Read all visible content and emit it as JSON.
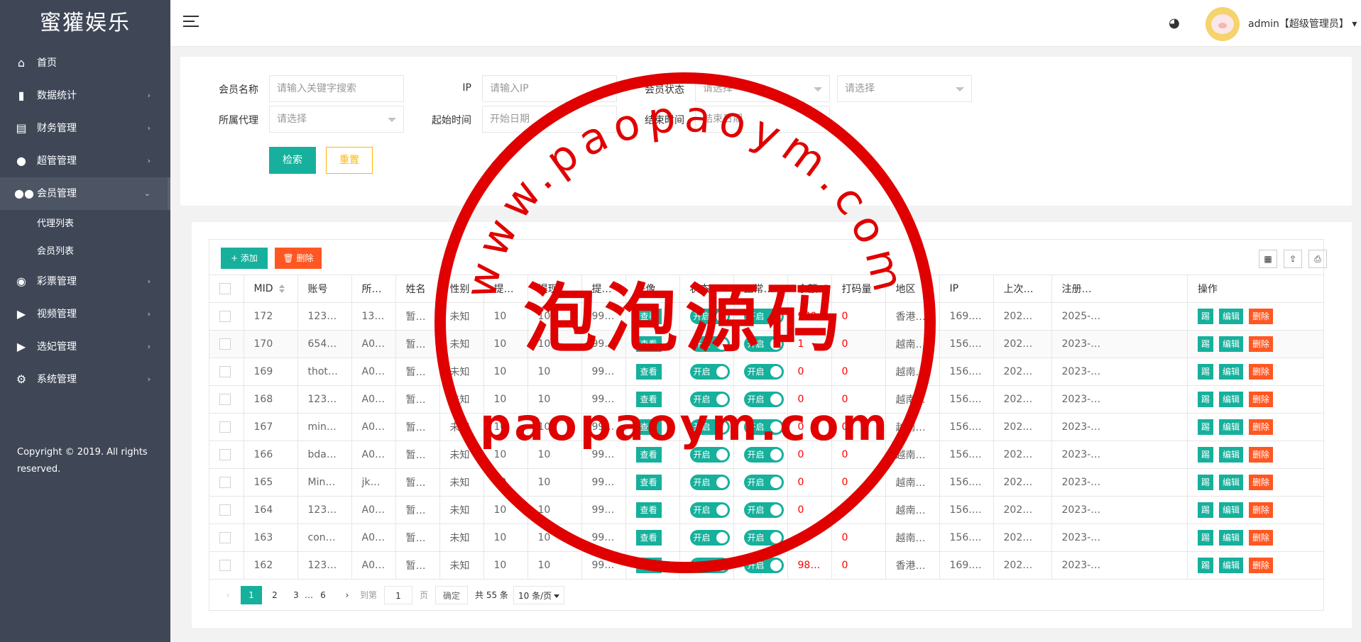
{
  "sidebar": {
    "logo": "蜜獾娱乐",
    "items": [
      {
        "label": "首页",
        "has_arrow": false
      },
      {
        "label": "数据统计",
        "has_arrow": true
      },
      {
        "label": "财务管理",
        "has_arrow": true
      },
      {
        "label": "超管管理",
        "has_arrow": true
      },
      {
        "label": "会员管理",
        "has_arrow": true,
        "expanded": true
      },
      {
        "label": "彩票管理",
        "has_arrow": true
      },
      {
        "label": "视频管理",
        "has_arrow": true
      },
      {
        "label": "选妃管理",
        "has_arrow": true
      },
      {
        "label": "系统管理",
        "has_arrow": true
      }
    ],
    "subitems": [
      "代理列表",
      "会员列表"
    ],
    "copyright": "Copyright © 2019. All rights reserved."
  },
  "header": {
    "user": "admin【超级管理员】"
  },
  "search": {
    "member_name_label": "会员名称",
    "member_name_placeholder": "请输入关键字搜索",
    "ip_label": "IP",
    "ip_placeholder": "请输入IP",
    "status_label": "会员状态",
    "status_value": "请选择",
    "status2_value": "请选择",
    "agent_label": "所属代理",
    "agent_value": "请选择",
    "start_label": "起始时间",
    "start_placeholder": "开始日期",
    "end_label": "结束时间",
    "end_placeholder": "结束日期",
    "search_btn": "检索",
    "reset_btn": "重置"
  },
  "toolbar": {
    "add_label": "+ 添加",
    "delete_label": "删除"
  },
  "table": {
    "headers": [
      "MID",
      "账号",
      "所属…",
      "姓名",
      "性别",
      "提现…",
      "提现…",
      "提现…",
      "头像",
      "状态",
      "正常…",
      "余额",
      "打码量",
      "地区",
      "IP",
      "上次…",
      "注册…",
      "操作"
    ],
    "switch_label": "开启",
    "view_label": "查看",
    "op_labels": [
      "踢",
      "编辑",
      "删除"
    ],
    "rows": [
      {
        "mid": "172",
        "account": "123…",
        "agent": "130…",
        "name": "暂未…",
        "gender": "未知",
        "w1": "10",
        "w2": "10",
        "w3": "999…",
        "balance": "980",
        "code": "0",
        "region": "香港…",
        "ip": "169.…",
        "last": "202…",
        "reg": "2025-…"
      },
      {
        "mid": "170",
        "account": "654…",
        "agent": "A001",
        "name": "暂未…",
        "gender": "未知",
        "w1": "10",
        "w2": "10",
        "w3": "999…",
        "balance": "1",
        "code": "0",
        "region": "越南…",
        "ip": "156.…",
        "last": "202…",
        "reg": "2023-…"
      },
      {
        "mid": "169",
        "account": "thot…",
        "agent": "A005",
        "name": "暂未…",
        "gender": "未知",
        "w1": "10",
        "w2": "10",
        "w3": "999…",
        "balance": "0",
        "code": "0",
        "region": "越南…",
        "ip": "156.…",
        "last": "202…",
        "reg": "2023-…"
      },
      {
        "mid": "168",
        "account": "123…",
        "agent": "A002",
        "name": "暂未…",
        "gender": "未知",
        "w1": "10",
        "w2": "10",
        "w3": "999…",
        "balance": "0",
        "code": "0",
        "region": "越南…",
        "ip": "156.…",
        "last": "202…",
        "reg": "2023-…"
      },
      {
        "mid": "167",
        "account": "min1…",
        "agent": "A004",
        "name": "暂未…",
        "gender": "未知",
        "w1": "10",
        "w2": "10",
        "w3": "999…",
        "balance": "0",
        "code": "0",
        "region": "越南…",
        "ip": "156.…",
        "last": "202…",
        "reg": "2023-…"
      },
      {
        "mid": "166",
        "account": "bdas…",
        "agent": "A003",
        "name": "暂未…",
        "gender": "未知",
        "w1": "10",
        "w2": "10",
        "w3": "999…",
        "balance": "0",
        "code": "0",
        "region": "越南…",
        "ip": "156.…",
        "last": "202…",
        "reg": "2023-…"
      },
      {
        "mid": "165",
        "account": "Min1…",
        "agent": "jk12…",
        "name": "暂未…",
        "gender": "未知",
        "w1": "10",
        "w2": "10",
        "w3": "999…",
        "balance": "0",
        "code": "0",
        "region": "越南…",
        "ip": "156.…",
        "last": "202…",
        "reg": "2023-…"
      },
      {
        "mid": "164",
        "account": "123…",
        "agent": "A007",
        "name": "暂未…",
        "gender": "未知",
        "w1": "10",
        "w2": "10",
        "w3": "999…",
        "balance": "0",
        "code": "0",
        "region": "越南…",
        "ip": "156.…",
        "last": "202…",
        "reg": "2023-…"
      },
      {
        "mid": "163",
        "account": "conb…",
        "agent": "A006",
        "name": "暂未…",
        "gender": "未知",
        "w1": "10",
        "w2": "10",
        "w3": "999…",
        "balance": "0",
        "code": "0",
        "region": "越南…",
        "ip": "156.…",
        "last": "202…",
        "reg": "2023-…"
      },
      {
        "mid": "162",
        "account": "123…",
        "agent": "A001",
        "name": "暂未…",
        "gender": "未知",
        "w1": "10",
        "w2": "10",
        "w3": "999…",
        "balance": "98680",
        "code": "0",
        "region": "香港…",
        "ip": "169.…",
        "last": "202…",
        "reg": "2023-…"
      }
    ]
  },
  "pager": {
    "current": "1",
    "pages": [
      "2",
      "3"
    ],
    "ellipsis": "…",
    "last": "6",
    "goto_label": "到第",
    "goto_value": "1",
    "page_unit": "页",
    "confirm": "确定",
    "total": "共 55 条",
    "per_page": "10 条/页"
  },
  "watermark": {
    "arc_text": "www.paopaoym.com",
    "title": "泡泡源码",
    "bottom_text": "paopaoym.com"
  },
  "colors": {
    "sidebar_bg": "#3f4757",
    "accent": "#16b09c",
    "danger": "#ff5722",
    "warning": "#ffb800",
    "stamp": "#e00000"
  }
}
